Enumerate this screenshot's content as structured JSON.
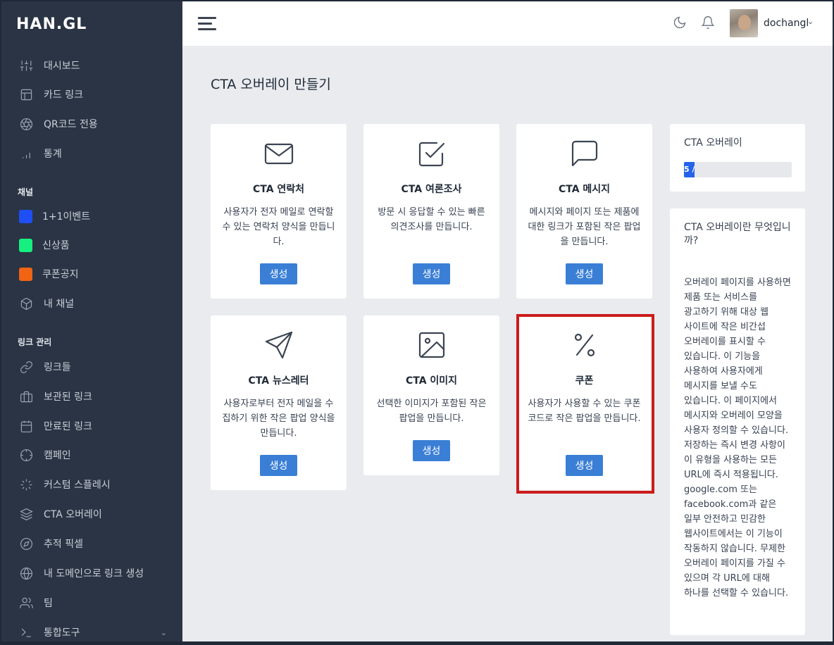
{
  "sidebar": {
    "logo": "HAN.GL",
    "items": [
      {
        "label": "대시보드",
        "icon": "sliders-icon"
      },
      {
        "label": "카드 링크",
        "icon": "layout-icon"
      },
      {
        "label": "QR코드 전용",
        "icon": "aperture-icon"
      },
      {
        "label": "통계",
        "icon": "bar-chart-icon"
      }
    ],
    "channel_section": "채널",
    "channels": [
      {
        "label": "1+1이벤트",
        "color": "#1d4ff5"
      },
      {
        "label": "신상품",
        "color": "#16f07f"
      },
      {
        "label": "쿠폰공지",
        "color": "#f06414"
      },
      {
        "label": "내 채널",
        "icon": "box-icon"
      }
    ],
    "links_section": "링크 관리",
    "links": [
      {
        "label": "링크들",
        "icon": "link-icon"
      },
      {
        "label": "보관된 링크",
        "icon": "briefcase-icon"
      },
      {
        "label": "만료된 링크",
        "icon": "calendar-icon"
      },
      {
        "label": "캠페인",
        "icon": "crosshair-icon"
      },
      {
        "label": "커스텀 스플레시",
        "icon": "loader-icon"
      },
      {
        "label": "CTA 오버레이",
        "icon": "layers-icon"
      },
      {
        "label": "추적 픽셀",
        "icon": "compass-icon"
      },
      {
        "label": "내 도메인으로 링크 생성",
        "icon": "globe-icon"
      },
      {
        "label": "팀",
        "icon": "users-icon"
      },
      {
        "label": "통합도구",
        "icon": "terminal-icon"
      }
    ]
  },
  "topbar": {
    "username": "dochangl"
  },
  "page_title": "CTA 오버레이 만들기",
  "cards": [
    {
      "title": "CTA 연락처",
      "desc": "사용자가 전자 메일로 연락할 수 있는 연락처 양식을 만듭니다.",
      "button": "생성",
      "icon": "mail-icon"
    },
    {
      "title": "CTA 여론조사",
      "desc": "방문 시 응답할 수 있는 빠른 의견조사를 만듭니다.",
      "button": "생성",
      "icon": "check-square-icon"
    },
    {
      "title": "CTA 메시지",
      "desc": "메시지와 페이지 또는 제품에 대한 링크가 포함된 작은 팝업을 만듭니다.",
      "button": "생성",
      "icon": "message-square-icon"
    },
    {
      "title": "CTA 뉴스레터",
      "desc": "사용자로부터 전자 메일을 수집하기 위한 작은 팝업 양식을 만듭니다.",
      "button": "생성",
      "icon": "send-icon"
    },
    {
      "title": "CTA 이미지",
      "desc": "선택한 이미지가 포함된 작은 팝업을 만듭니다.",
      "button": "생성",
      "icon": "image-icon"
    },
    {
      "title": "쿠폰",
      "desc": "사용자가 사용할 수 있는 쿠폰 코드로 작은 팝업을 만듭니다.",
      "button": "생성",
      "icon": "percent-icon"
    }
  ],
  "usage": {
    "title": "CTA 오버레이",
    "progress_text": "5 /",
    "progress_fraction": 0.1
  },
  "info": {
    "title": "CTA 오버레이란 무엇입니까?",
    "body": "오버레이 페이지를 사용하면 제품 또는 서비스를 광고하기 위해 대상 웹 사이트에 작은 비간섭 오버레이를 표시할 수 있습니다. 이 기능을 사용하여 사용자에게 메시지를 보낼 수도 있습니다. 이 페이지에서 메시지와 오버레이 모양을 사용자 정의할 수 있습니다. 저장하는 즉시 변경 사항이 이 유형을 사용하는 모든 URL에 즉시 적용됩니다. google.com 또는 facebook.com과 같은 일부 안전하고 민감한 웹사이트에서는 이 기능이 작동하지 않습니다. 무제한 오버레이 페이지를 가질 수 있으며 각 URL에 대해 하나를 선택할 수 있습니다."
  }
}
